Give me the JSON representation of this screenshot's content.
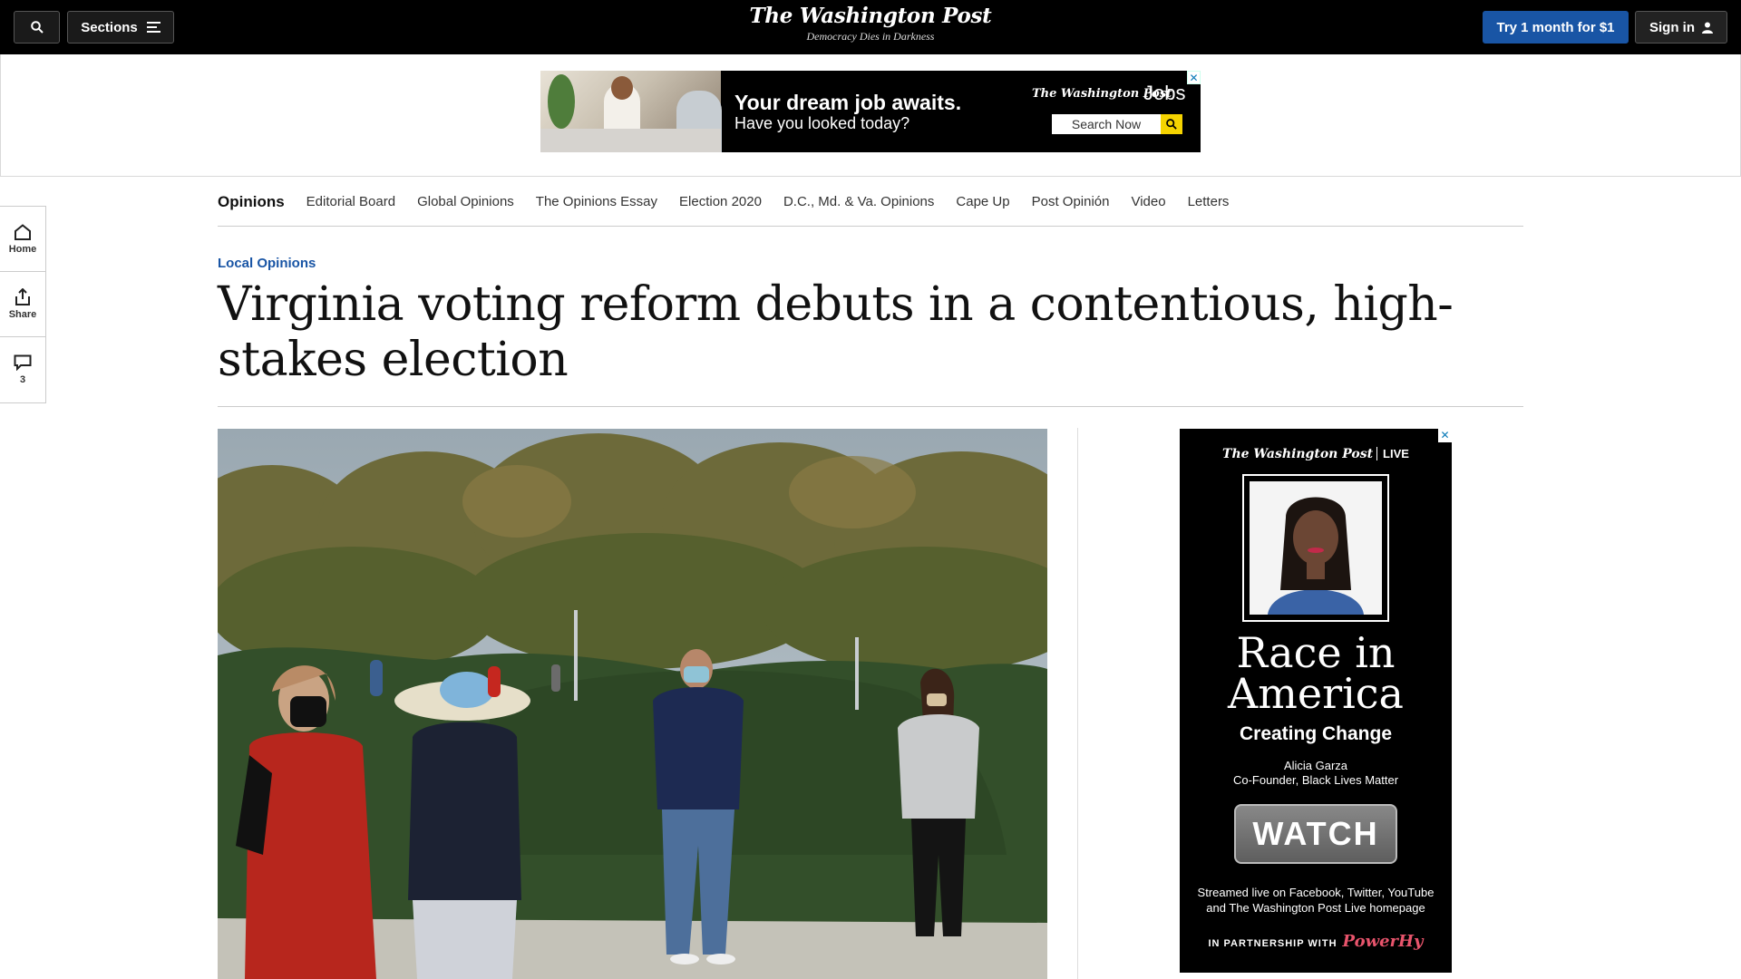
{
  "header": {
    "sections_label": "Sections",
    "logo": "The Washington Post",
    "tagline": "Democracy Dies in Darkness",
    "try_label": "Try 1 month for $1",
    "signin_label": "Sign in"
  },
  "top_ad": {
    "headline": "Your dream job awaits.",
    "subline": "Have you looked today?",
    "brand": "The Washington Post",
    "brand_suffix": "Jobs",
    "search_label": "Search Now",
    "close": "✕"
  },
  "subnav": {
    "items": [
      "Opinions",
      "Editorial Board",
      "Global Opinions",
      "The Opinions Essay",
      "Election 2020",
      "D.C., Md. & Va. Opinions",
      "Cape Up",
      "Post Opinión",
      "Video",
      "Letters"
    ]
  },
  "rail": {
    "home_label": "Home",
    "share_label": "Share",
    "comments_count": "3"
  },
  "article": {
    "kicker": "Local Opinions",
    "headline": "Virginia voting reform debuts in a contentious, high-stakes election"
  },
  "side_ad": {
    "brand": "The Washington Post",
    "brand_suffix": "LIVE",
    "title_line1": "Race in",
    "title_line2": "America",
    "subtitle": "Creating Change",
    "speaker_name": "Alicia Garza",
    "speaker_role": "Co-Founder, Black Lives Matter",
    "cta": "WATCH",
    "stream_line1": "Streamed live on Facebook, Twitter, YouTube",
    "stream_line2": "and The Washington Post Live homepage",
    "partner_label": "IN PARTNERSHIP WITH",
    "partner_name": "PowerHy",
    "close": "✕"
  },
  "colors": {
    "accent_blue": "#1955a5",
    "topbar": "#000000"
  }
}
